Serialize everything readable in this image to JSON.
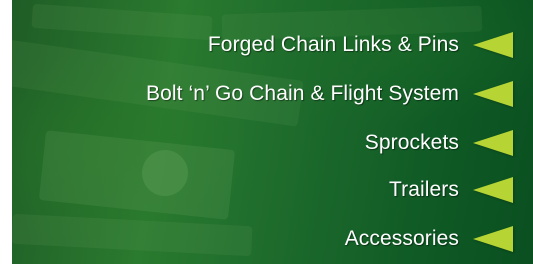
{
  "theme": {
    "background": "#1f6a2a",
    "text_color": "#ffffff",
    "arrow_color": "#b6d433"
  },
  "menu": {
    "items": [
      {
        "label": "Forged Chain Links & Pins",
        "icon": "triangle-left-icon"
      },
      {
        "label": "Bolt ‘n’ Go Chain & Flight System",
        "icon": "triangle-left-icon"
      },
      {
        "label": "Sprockets",
        "icon": "triangle-left-icon"
      },
      {
        "label": "Trailers",
        "icon": "triangle-left-icon"
      },
      {
        "label": "Accessories",
        "icon": "triangle-left-icon"
      }
    ]
  }
}
